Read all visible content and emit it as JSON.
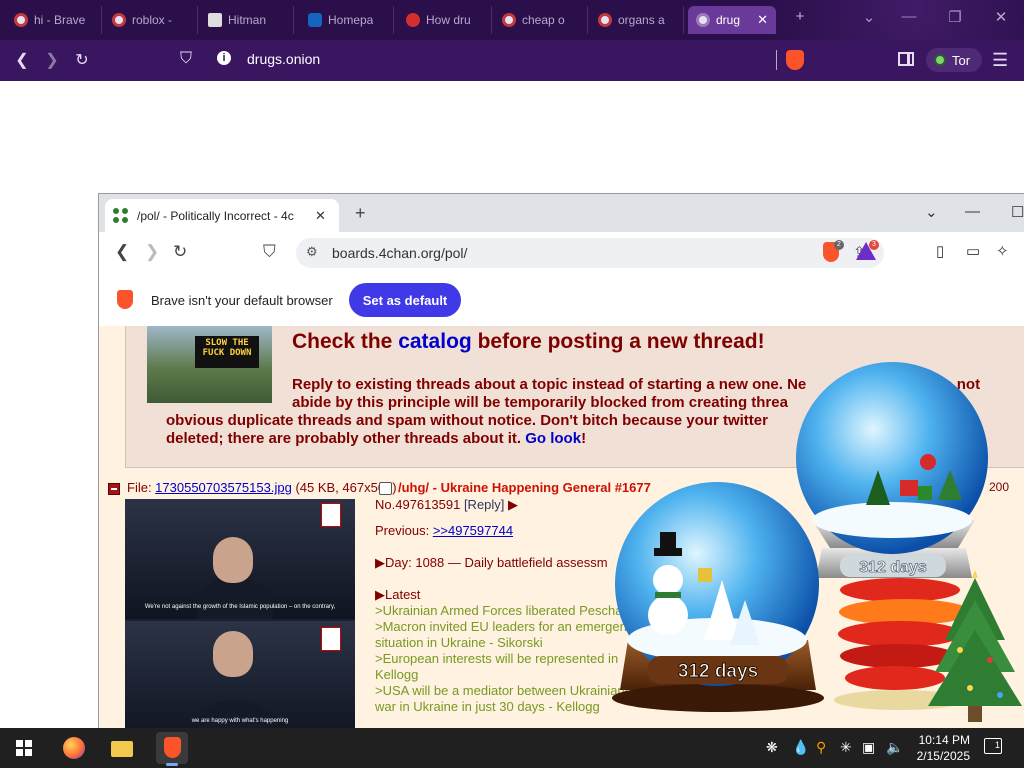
{
  "outer_browser": {
    "tabs": [
      {
        "label": "hi - Brave",
        "icon": "tor-onion-icon"
      },
      {
        "label": "roblox -",
        "icon": "tor-onion-icon"
      },
      {
        "label": "Hitman",
        "icon": "hitman-icon"
      },
      {
        "label": "Homepa",
        "icon": "c-logo-icon"
      },
      {
        "label": "How dru",
        "icon": "apple-icon"
      },
      {
        "label": "cheap o",
        "icon": "tor-onion-icon"
      },
      {
        "label": "organs a",
        "icon": "tor-onion-icon"
      },
      {
        "label": "drug",
        "icon": "tor-onion-icon",
        "active": true
      }
    ],
    "url": "drugs.onion",
    "tor_label": "Tor",
    "accent": "#6a3a9a"
  },
  "inner_browser": {
    "tab_title": "/pol/ - Politically Incorrect - 4c",
    "url": "boards.4chan.org/pol/",
    "shield_badge": "2",
    "rewards_badge": "3",
    "infobar_text": "Brave isn't your default browser",
    "set_default_label": "Set as default"
  },
  "notice": {
    "sign_text": "SLOW THE FUCK DOWN",
    "heading_pre": "Check the ",
    "heading_link": "catalog",
    "heading_post": " before posting a new thread!",
    "body_line1": "Reply to existing threads about a topic instead of starting a new one. Ne",
    "body_line1b": "do not",
    "body_line2": "abide by this principle will be temporarily blocked from creating threa",
    "body_line3": "obvious duplicate threads and spam without notice. Don't bitch because your twitter",
    "body_line4": "deleted; there are probably other threads about it. ",
    "body_link": "Go look",
    "body_end": "!"
  },
  "post": {
    "file_label": "File: ",
    "file_link": "1730550703575153.jpg",
    "file_meta": "(45 KB, 467x506)",
    "subject": "/uhg/ - Ukraine Happening General #1677",
    "tail": "200",
    "no_label": "No.497613591",
    "reply_label": "[Reply]",
    "reply_arrow": "▶",
    "previous_label": "Previous: ",
    "previous_link": ">>497597744",
    "day_line": "▶Day: 1088 — Daily battlefield assessm",
    "latest_heading": "▶Latest",
    "quotes": [
      ">Ukrainian Armed Forces liberated Pescha",
      ">Macron invited EU leaders for an emergen",
      "situation in Ukraine - Sikorski",
      ">European interests will be represented in",
      "Kellogg",
      ">USA will be a mediator between Ukrainians and",
      "war in Ukraine in just 30 days - Kellogg"
    ],
    "thumb_sub_top": "We're not against the growth of the Islamic population – on the contrary,",
    "thumb_sub_bottom": "we are happy with what's happening"
  },
  "decorations": {
    "globe1_label": "312 days",
    "globe2_label": "312 days"
  },
  "taskbar": {
    "time": "10:14 PM",
    "date": "2/15/2025",
    "notification_count": "1"
  }
}
